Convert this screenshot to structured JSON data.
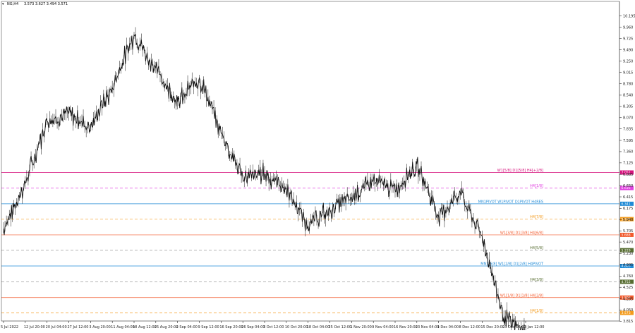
{
  "header": {
    "symbol": "NG,H4",
    "ohlc": "3.573 3.627 3.494 3.571"
  },
  "chart_data": {
    "type": "line",
    "title": "",
    "xlabel": "",
    "ylabel": "",
    "ylim": [
      3.82,
      10.5
    ],
    "grid": false,
    "y_ticks": [
      "10.195",
      "9.960",
      "9.725",
      "9.490",
      "9.250",
      "9.015",
      "8.780",
      "8.540",
      "8.305",
      "8.070",
      "7.835",
      "7.595",
      "7.360",
      "7.125",
      "6.885",
      "6.650",
      "6.415",
      "6.175",
      "5.940",
      "5.705",
      "5.470",
      "5.230",
      "4.995",
      "4.760",
      "4.525",
      "4.285",
      "4.050",
      "3.815",
      "3.580",
      "3.345"
    ],
    "x_ticks": [
      "5 Jul 2022",
      "12 Jul 20:00",
      "20 Jul 04:00",
      "27 Jul 12:00",
      "3 Aug 20:00",
      "11 Aug 04:00",
      "18 Aug 12:00",
      "25 Aug 20:00",
      "2 Sep 04:00",
      "9 Sep 12:00",
      "16 Sep 20:00",
      "26 Sep 04:00",
      "3 Oct 12:00",
      "10 Oct 20:00",
      "18 Oct 04:00",
      "25 Oct 12:00",
      "1 Nov 20:00",
      "9 Nov 04:00",
      "16 Nov 20:00",
      "23 Nov 04:00",
      "1 Dec 04:00",
      "8 Dec 12:00",
      "15 Dec 20:00",
      "23 Dec 04:00",
      "3 Jan 12:00"
    ],
    "series": [
      {
        "name": "",
        "color": "#111111",
        "x": [
          "5 Jul 2022",
          "12 Jul 20:00",
          "20 Jul 04:00",
          "27 Jul 12:00",
          "3 Aug 20:00",
          "11 Aug 04:00",
          "18 Aug 12:00",
          "25 Aug 20:00",
          "2 Sep 04:00",
          "9 Sep 12:00",
          "16 Sep 20:00",
          "26 Sep 04:00",
          "3 Oct 12:00",
          "10 Oct 20:00",
          "18 Oct 04:00",
          "25 Oct 12:00",
          "1 Nov 20:00",
          "9 Nov 04:00",
          "16 Nov 20:00",
          "23 Nov 04:00",
          "1 Dec 04:00",
          "8 Dec 12:00",
          "15 Dec 20:00",
          "23 Dec 04:00",
          "3 Jan 12:00"
        ],
        "values": [
          5.75,
          6.7,
          8.0,
          8.15,
          7.85,
          8.7,
          9.8,
          9.1,
          8.4,
          8.9,
          7.75,
          6.8,
          6.9,
          6.6,
          5.8,
          6.15,
          6.4,
          6.75,
          6.55,
          7.1,
          6.0,
          6.5,
          5.6,
          3.9,
          3.571
        ]
      }
    ],
    "levels": [
      {
        "label": "W1[5/8] D1[5/8] H4[+2/8]",
        "value": 6.924,
        "badge": "7.051",
        "color": "#d6117c",
        "style": "solid"
      },
      {
        "label": "H4[1/8]",
        "value": 6.6,
        "badge": "6.635",
        "color": "#e040e0",
        "style": "dash"
      },
      {
        "label": "MN1PIVOT W1PIVOT D1PIVOT H4RES",
        "value": 6.27,
        "badge": "6.341",
        "color": "#1f8ad6",
        "style": "solid"
      },
      {
        "label": "H4[7/8]",
        "value": 5.95,
        "badge": "5.979",
        "color": "#f39a1b",
        "style": "dash"
      },
      {
        "label": "W1[3/8] D1[3/8] H4[6/8]",
        "value": 5.62,
        "badge": "5.688",
        "color": "#f25a2d",
        "style": "solid"
      },
      {
        "label": "H4[5/8]",
        "value": 5.3,
        "badge": "5.229",
        "color": "#556b2f",
        "style": "dash-gray"
      },
      {
        "label": "MN1[5/8] W1[2/8] D1[2/8] H4PIVOT",
        "value": 4.97,
        "badge": "4.885",
        "color": "#1f8ad6",
        "style": "solid"
      },
      {
        "label": "H4[3/8]",
        "value": 4.64,
        "badge": "4.752",
        "color": "#556b2f",
        "style": "dash-gray"
      },
      {
        "label": "W1[1/8] D1[1/8] H4[2/8]",
        "value": 4.31,
        "badge": "3.896",
        "color": "#f25a2d",
        "style": "solid"
      },
      {
        "label": "H4[1/8]",
        "value": 3.99,
        "badge": "3.573",
        "color": "#f39a1b",
        "style": "dash"
      }
    ],
    "last_price": "3.571"
  }
}
